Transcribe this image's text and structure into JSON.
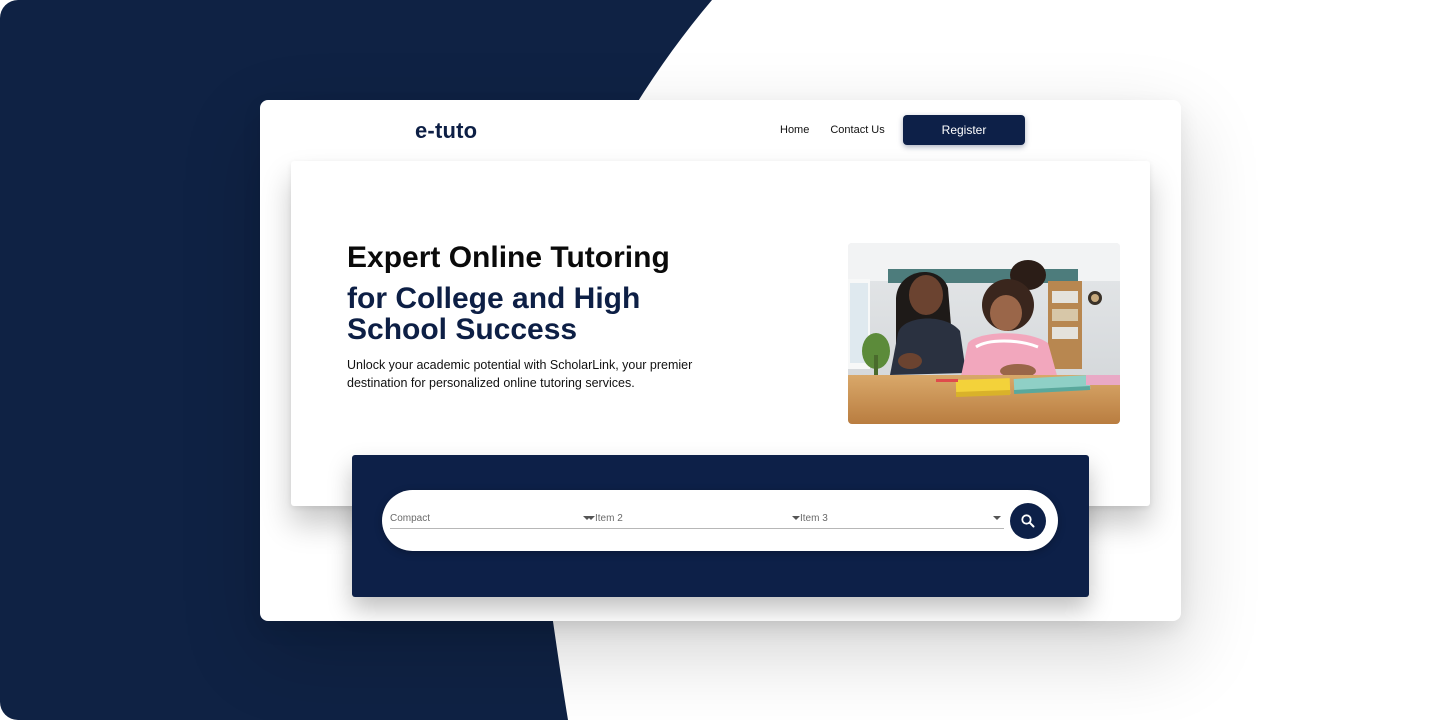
{
  "header": {
    "logo": "e-tuto",
    "nav": {
      "home_label": "Home",
      "contact_label": "Contact Us",
      "register_label": "Register"
    }
  },
  "hero": {
    "title": "Expert Online Tutoring",
    "subtitle": "for College and High School Success",
    "description": "Unlock your academic potential with ScholarLink, your premier destination for personalized online tutoring services.",
    "image_icon": "tutor-and-student-photo"
  },
  "search": {
    "fields": [
      {
        "label": "Compact",
        "icon": "chevron-down-icon"
      },
      {
        "label": "Item 2",
        "icon": "chevron-down-icon"
      },
      {
        "label": "Item 3",
        "icon": "chevron-down-icon"
      }
    ],
    "button_icon": "search-icon"
  },
  "colors": {
    "brand_navy": "#0d2048",
    "heading_navy": "#0d1f45",
    "background_navy": "#0f2244"
  }
}
